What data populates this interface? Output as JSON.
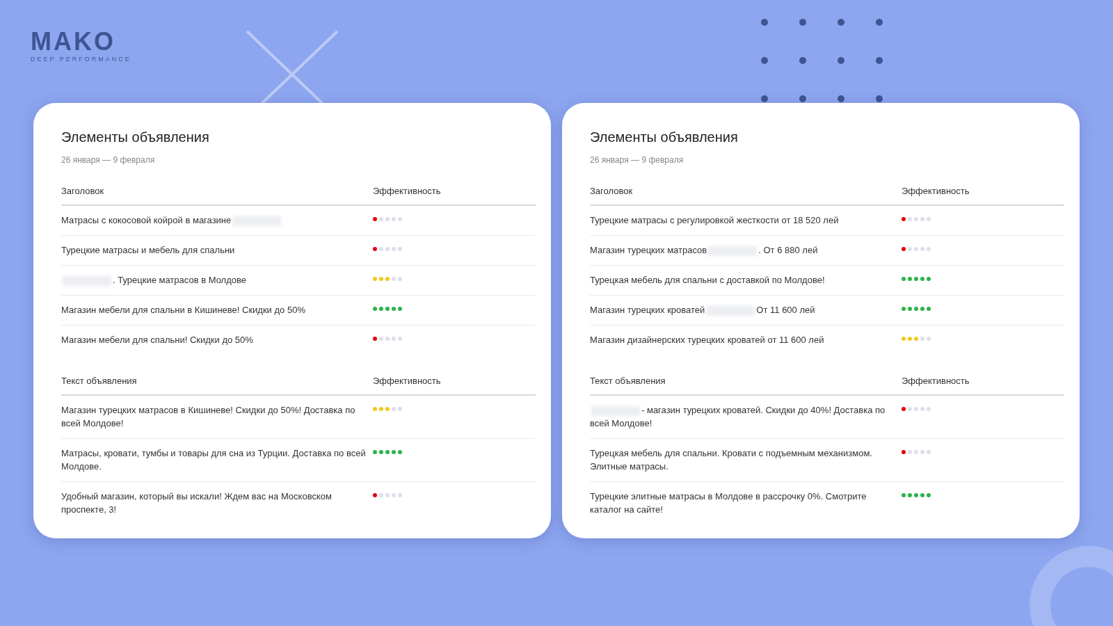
{
  "logo": {
    "name": "MAKO",
    "tagline": "DEEP PERFORMANCE"
  },
  "cards": [
    {
      "title": "Элементы объявления",
      "period": "26 января — 9 февраля",
      "sections": [
        {
          "column_1": "Заголовок",
          "column_2": "Эффективность",
          "rows": [
            {
              "parts": [
                {
                  "kind": "text",
                  "text": "Матрасы с кокосовой койрой в магазине"
                },
                {
                  "kind": "redacted"
                }
              ],
              "stars": 1
            },
            {
              "parts": [
                {
                  "kind": "text",
                  "text": "Турецкие матрасы и мебель для спальни"
                }
              ],
              "stars": 1
            },
            {
              "parts": [
                {
                  "kind": "redacted"
                },
                {
                  "kind": "text",
                  "text": ". Турецкие матрасов в Молдове"
                }
              ],
              "stars": 3
            },
            {
              "parts": [
                {
                  "kind": "text",
                  "text": "Магазин мебели для спальни в Кишиневе! Скидки до 50%"
                }
              ],
              "stars": 5
            },
            {
              "parts": [
                {
                  "kind": "text",
                  "text": "Магазин мебели для спальни! Скидки до 50%"
                }
              ],
              "stars": 1
            }
          ]
        },
        {
          "column_1": "Текст объявления",
          "column_2": "Эффективность",
          "rows": [
            {
              "parts": [
                {
                  "kind": "text",
                  "text": "Магазин турецких матрасов в Кишиневе! Скидки до 50%! Доставка по всей Молдове!"
                }
              ],
              "stars": 3
            },
            {
              "parts": [
                {
                  "kind": "text",
                  "text": "Матрасы, кровати, тумбы и товары для сна из Турции. Доставка по всей Молдове."
                }
              ],
              "stars": 5
            },
            {
              "parts": [
                {
                  "kind": "text",
                  "text": "Удобный магазин, который вы искали! Ждем вас на Московском проспекте, 3!"
                }
              ],
              "stars": 1
            }
          ]
        }
      ]
    },
    {
      "title": "Элементы объявления",
      "period": "26 января — 9 февраля",
      "sections": [
        {
          "column_1": "Заголовок",
          "column_2": "Эффективность",
          "rows": [
            {
              "parts": [
                {
                  "kind": "text",
                  "text": "Турецкие матрасы с регулировкой жесткости от 18 520 лей"
                }
              ],
              "stars": 1
            },
            {
              "parts": [
                {
                  "kind": "text",
                  "text": "Магазин турецких матрасов"
                },
                {
                  "kind": "redacted"
                },
                {
                  "kind": "text",
                  "text": ". От 6 880 лей"
                }
              ],
              "stars": 1
            },
            {
              "parts": [
                {
                  "kind": "text",
                  "text": "Турецкая мебель для спальни с доставкой по Молдове!"
                }
              ],
              "stars": 5
            },
            {
              "parts": [
                {
                  "kind": "text",
                  "text": "Магазин турецких кроватей"
                },
                {
                  "kind": "redacted"
                },
                {
                  "kind": "text",
                  "text": "От 11 600 лей"
                }
              ],
              "stars": 5
            },
            {
              "parts": [
                {
                  "kind": "text",
                  "text": "Магазин дизайнерских турецких кроватей от 11 600 лей"
                }
              ],
              "stars": 3
            }
          ]
        },
        {
          "column_1": "Текст объявления",
          "column_2": "Эффективность",
          "rows": [
            {
              "parts": [
                {
                  "kind": "redacted"
                },
                {
                  "kind": "text",
                  "text": "- магазин турецких кроватей. Скидки до 40%! Доставка по"
                },
                {
                  "kind": "line",
                  "text": "всей Молдове!"
                }
              ],
              "stars": 1
            },
            {
              "parts": [
                {
                  "kind": "text",
                  "text": "Турецкая мебель для спальни. Кровати с подъемным механизмом. Элитные матрасы."
                }
              ],
              "stars": 1
            },
            {
              "parts": [
                {
                  "kind": "text",
                  "text": "Турецкие элитные матрасы в Молдове в рассрочку 0%. Смотрите каталог на сайте!"
                }
              ],
              "stars": 5
            }
          ]
        }
      ]
    }
  ]
}
